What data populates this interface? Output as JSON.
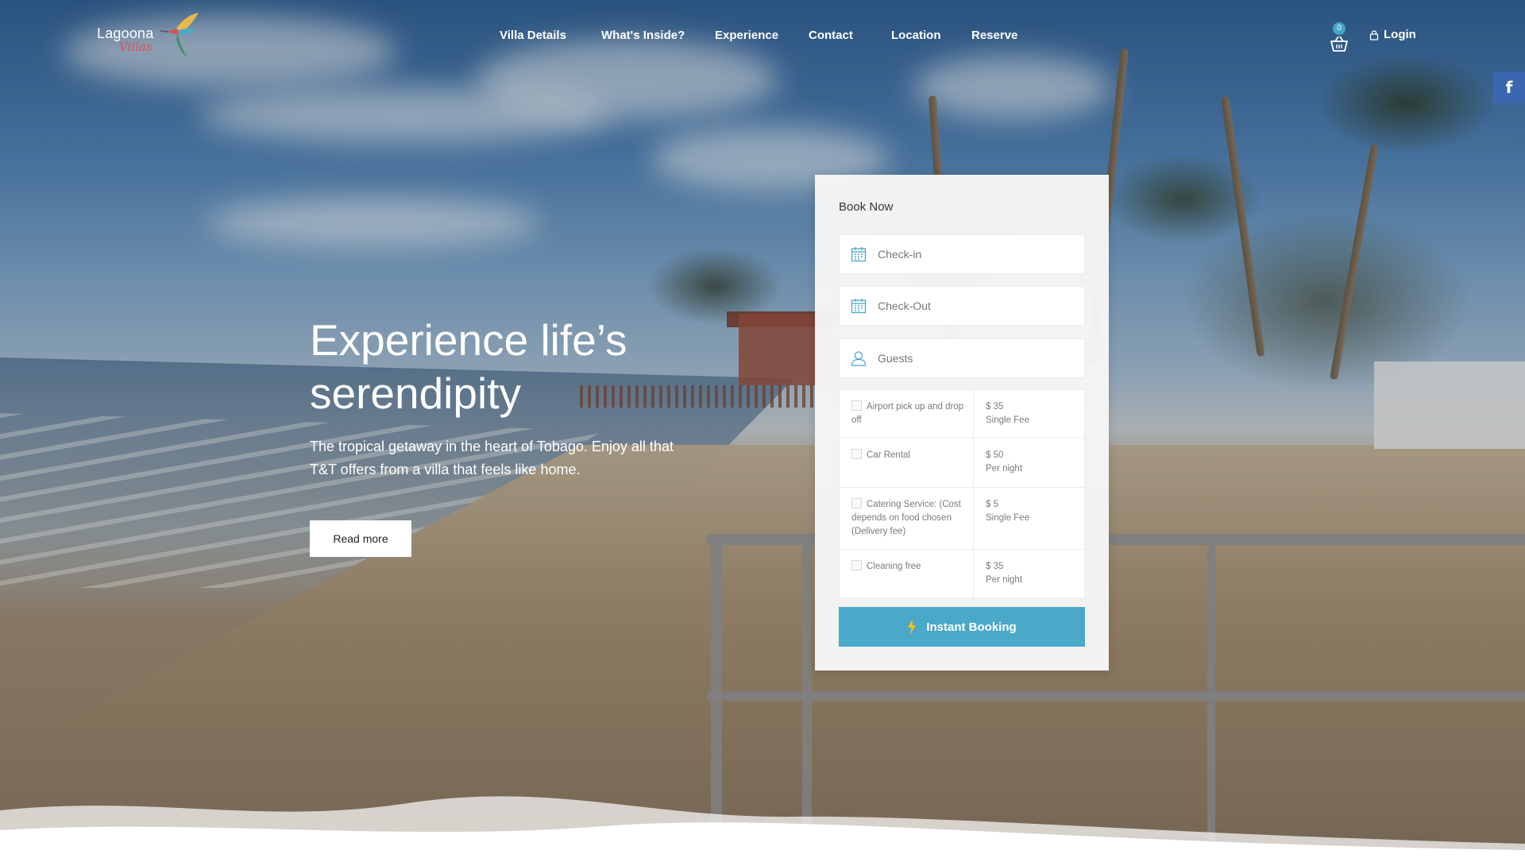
{
  "brand": {
    "name": "Lagoona",
    "script": "Villas"
  },
  "nav": {
    "items": [
      {
        "label": "Villa Details"
      },
      {
        "label": "What's Inside?"
      },
      {
        "label": "Experience"
      },
      {
        "label": "Contact"
      },
      {
        "label": "Location"
      },
      {
        "label": "Reserve"
      }
    ]
  },
  "header": {
    "cart_count": "0",
    "login_label": "Login",
    "social_icon": "facebook-icon"
  },
  "hero": {
    "title": "Experience life’s serendipity",
    "subtitle": "The tropical getaway in the heart of Tobago. Enjoy all that T&T offers from a villa that feels like home.",
    "cta_label": "Read more"
  },
  "booking": {
    "title": "Book Now",
    "checkin_placeholder": "Check-in",
    "checkout_placeholder": "Check-Out",
    "guests_placeholder": "Guests",
    "extras": [
      {
        "label": "Airport pick up and drop off",
        "price": "$ 35",
        "unit": "Single Fee"
      },
      {
        "label": "Car Rental",
        "price": "$ 50",
        "unit": "Per night"
      },
      {
        "label": "Catering Service: (Cost depends on food chosen (Delivery fee)",
        "price": "$ 5",
        "unit": "Single Fee"
      },
      {
        "label": "Cleaning free",
        "price": "$ 35",
        "unit": "Per night"
      }
    ],
    "button_label": "Instant Booking"
  },
  "colors": {
    "accent": "#4aa8c8",
    "facebook": "#3b66b0",
    "panel": "#f6f6f6"
  }
}
